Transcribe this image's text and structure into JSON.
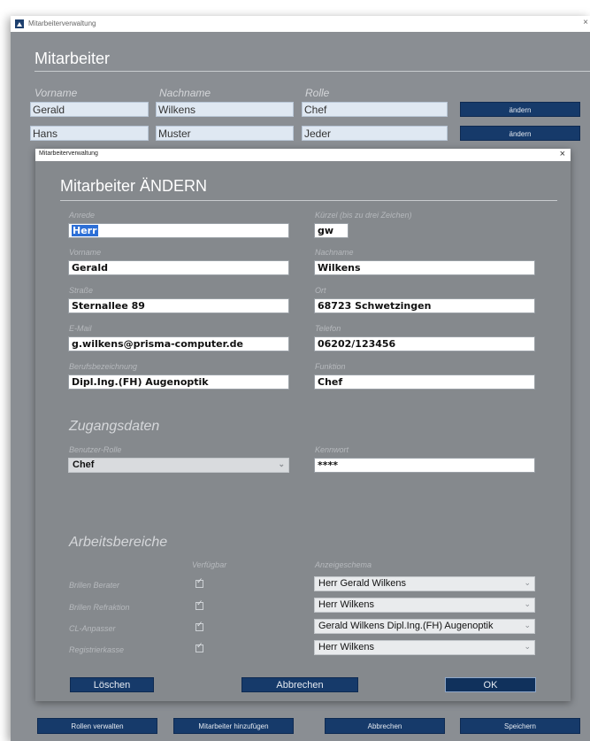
{
  "outer": {
    "window_title": "Mitarbeiterverwaltung",
    "heading": "Mitarbeiter",
    "columns": [
      "Vorname",
      "Nachname",
      "Rolle"
    ],
    "rows": [
      {
        "vorname": "Gerald",
        "nachname": "Wilkens",
        "rolle": "Chef",
        "button": "ändern"
      },
      {
        "vorname": "Hans",
        "nachname": "Muster",
        "rolle": "Jeder",
        "button": "ändern"
      }
    ],
    "bottom_buttons": {
      "rollen": "Rollen verwalten",
      "hinzufuegen": "Mitarbeiter hinzufügen",
      "abbrechen": "Abbrechen",
      "speichern": "Speichern"
    }
  },
  "dialog": {
    "window_title": "Mitarbeiterverwaltung",
    "heading": "Mitarbeiter ÄNDERN",
    "fields": {
      "anrede": {
        "label": "Anrede",
        "value": "Herr"
      },
      "kuerzel": {
        "label": "Kürzel (bis zu drei Zeichen)",
        "value": "gw"
      },
      "vorname": {
        "label": "Vorname",
        "value": "Gerald"
      },
      "nachname": {
        "label": "Nachname",
        "value": "Wilkens"
      },
      "strasse": {
        "label": "Straße",
        "value": "Sternallee 89"
      },
      "ort": {
        "label": "Ort",
        "value": "68723 Schwetzingen"
      },
      "email": {
        "label": "E-Mail",
        "value": "g.wilkens@prisma-computer.de"
      },
      "telefon": {
        "label": "Telefon",
        "value": "06202/123456"
      },
      "beruf": {
        "label": "Berufsbezeichnung",
        "value": "Dipl.Ing.(FH) Augenoptik"
      },
      "funktion": {
        "label": "Funktion",
        "value": "Chef"
      }
    },
    "zugang": {
      "title": "Zugangsdaten",
      "rolle_label": "Benutzer-Rolle",
      "rolle_value": "Chef",
      "kennwort_label": "Kennwort",
      "kennwort_value": "****"
    },
    "bereiche": {
      "title": "Arbeitsbereiche",
      "col_verfuegbar": "Verfügbar",
      "col_schema": "Anzeigeschema",
      "rows": [
        {
          "name": "Brillen Berater",
          "checked": true,
          "schema": "Herr Gerald Wilkens"
        },
        {
          "name": "Brillen Refraktion",
          "checked": true,
          "schema": "Herr Wilkens"
        },
        {
          "name": "CL-Anpasser",
          "checked": true,
          "schema": "Gerald Wilkens Dipl.Ing.(FH) Augenoptik"
        },
        {
          "name": "Registrierkasse",
          "checked": true,
          "schema": "Herr Wilkens"
        }
      ]
    },
    "buttons": {
      "loeschen": "Löschen",
      "abbrechen": "Abbrechen",
      "ok": "OK"
    }
  },
  "colors": {
    "accent_dark_blue": "#163a6a",
    "panel_gray": "#8a8e93",
    "selection_blue": "#2d6fd6"
  }
}
